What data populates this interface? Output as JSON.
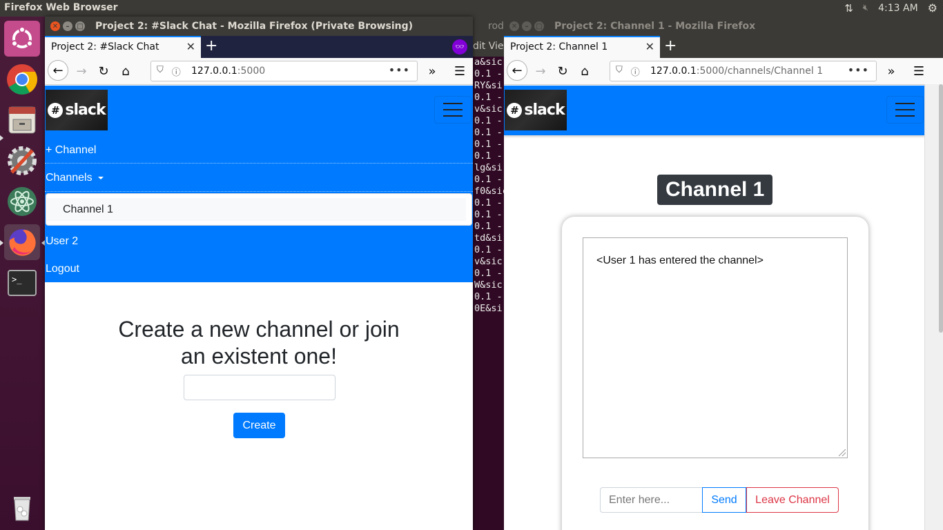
{
  "top_panel": {
    "app_title": "Firefox Web Browser",
    "clock": "4:13 AM"
  },
  "launcher": {
    "items": [
      "ubuntu-dash",
      "chrome",
      "files",
      "settings",
      "atom",
      "firefox",
      "terminal",
      "trash"
    ]
  },
  "terminal": {
    "title_frag": "rod",
    "menu_frag": "dit  Vie",
    "lines": [
      "a&sic",
      "0.1 -",
      "RY&si",
      "0.1 -",
      "v&sic",
      "0.1 -",
      "0.1 -",
      "0.1 -",
      "0.1 -",
      "lg&si",
      "0.1 -",
      "f0&sic",
      "0.1 -",
      "0.1 -",
      "0.1 -",
      "td&si",
      "0.1 -",
      "v&sic",
      "0.1 -",
      "W&sic",
      "0.1 -",
      "0E&si"
    ]
  },
  "left_window": {
    "title": "Project 2: #Slack Chat - Mozilla Firefox (Private Browsing)",
    "tab_title": "Project 2: #Slack Chat",
    "url_host": "127.0.0.1",
    "url_rest": ":5000",
    "brand": "slack",
    "nav": {
      "add_channel": "+ Channel",
      "channels": "Channels",
      "dropdown_item": "Channel 1",
      "user": "User 2",
      "logout": "Logout"
    },
    "main": {
      "heading_line1": "Create a new channel or join",
      "heading_line2": "an existent one!",
      "input_value": "",
      "create_button": "Create"
    }
  },
  "right_window": {
    "title": "Project 2: Channel 1 - Mozilla Firefox",
    "tab_title": "Project 2: Channel 1",
    "url_host": "127.0.0.1",
    "url_rest": ":5000/channels/Channel 1",
    "brand": "slack",
    "channel_title": "Channel 1",
    "chat_message": "<User 1 has entered the channel>",
    "message_placeholder": "Enter here...",
    "send_button": "Send",
    "leave_button": "Leave Channel"
  },
  "colors": {
    "bootstrap_primary": "#007bff",
    "bootstrap_danger": "#dc3545",
    "dark": "#343a40",
    "ubuntu_panel": "#3b3a36",
    "close_btn": "#e95420"
  }
}
